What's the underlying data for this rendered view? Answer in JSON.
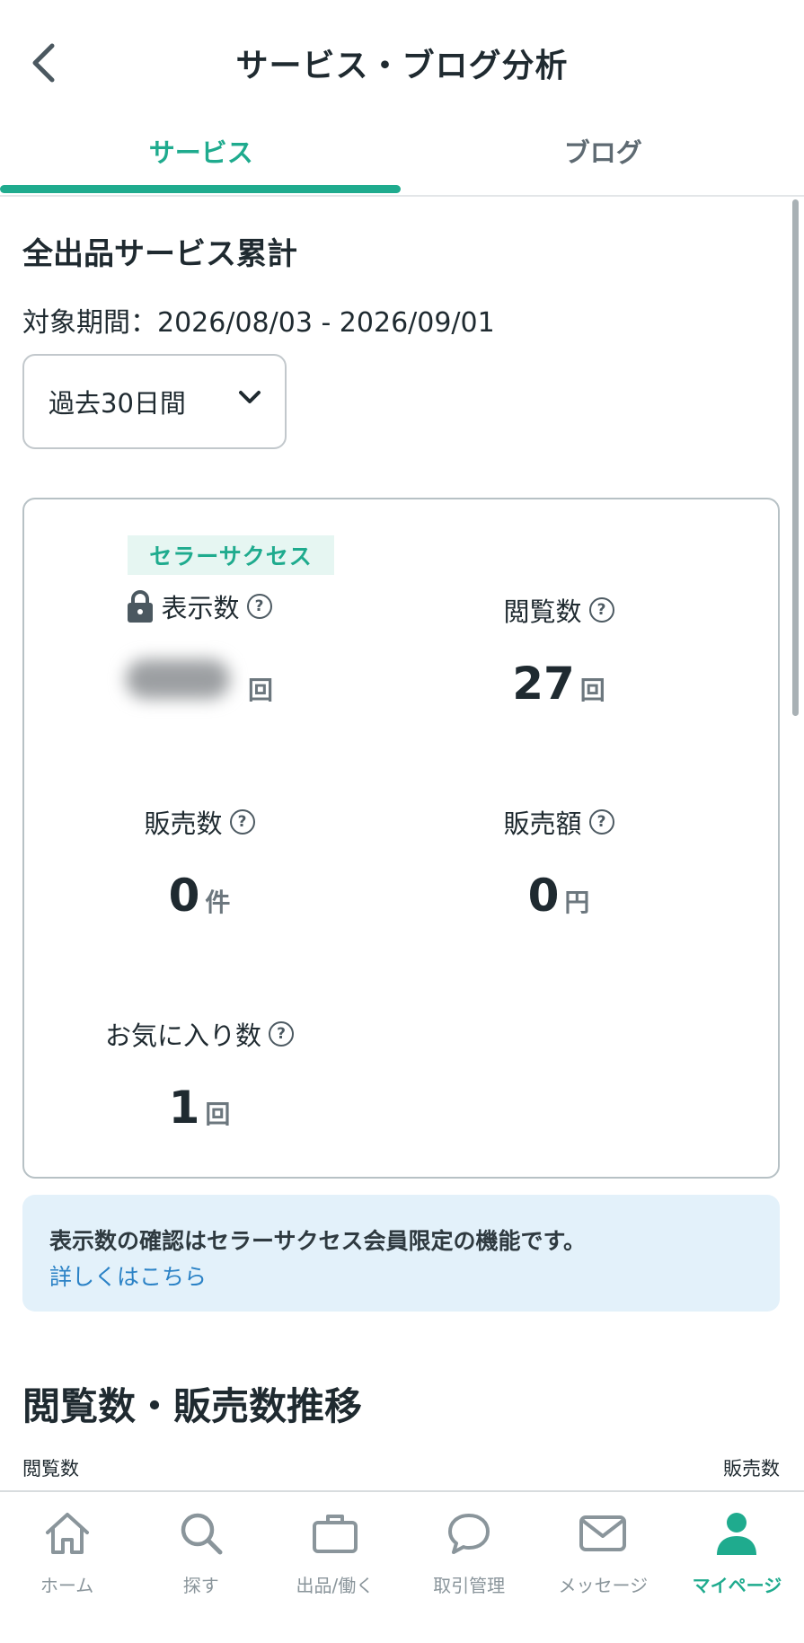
{
  "header": {
    "title": "サービス・ブログ分析"
  },
  "tabs": [
    {
      "label": "サービス",
      "active": true
    },
    {
      "label": "ブログ",
      "active": false
    }
  ],
  "summary": {
    "title": "全出品サービス累計",
    "period": "対象期間：2026/08/03 - 2026/09/01",
    "range_select": {
      "value": "過去30日間"
    }
  },
  "stats": {
    "badge": "セラーサクセス",
    "impressions": {
      "label": "表示数",
      "value": "",
      "unit": "回",
      "locked": true
    },
    "views": {
      "label": "閲覧数",
      "value": "27",
      "unit": "回"
    },
    "sales_count": {
      "label": "販売数",
      "value": "0",
      "unit": "件"
    },
    "sales_amount": {
      "label": "販売額",
      "value": "0",
      "unit": "円"
    },
    "favorites": {
      "label": "お気に入り数",
      "value": "1",
      "unit": "回"
    }
  },
  "info": {
    "text": "表示数の確認はセラーサクセス会員限定の機能です。",
    "link": "詳しくはこちら"
  },
  "trend": {
    "title": "閲覧数・販売数推移",
    "left_axis": "閲覧数",
    "right_axis": "販売数"
  },
  "nav": [
    {
      "label": "ホーム",
      "icon": "home-icon",
      "active": false
    },
    {
      "label": "探す",
      "icon": "search-icon",
      "active": false
    },
    {
      "label": "出品/働く",
      "icon": "briefcase-icon",
      "active": false
    },
    {
      "label": "取引管理",
      "icon": "chat-bubble-icon",
      "active": false
    },
    {
      "label": "メッセージ",
      "icon": "mail-icon",
      "active": false
    },
    {
      "label": "マイページ",
      "icon": "person-icon",
      "active": true
    }
  ],
  "colors": {
    "accent": "#1fab8e",
    "link": "#2b82c6",
    "info_bg": "#e3f1fa"
  }
}
